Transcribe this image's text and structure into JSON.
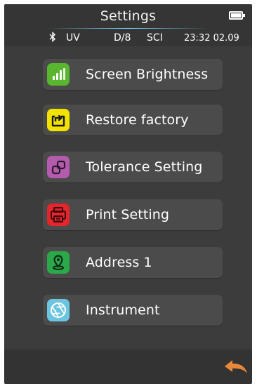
{
  "header": {
    "title": "Settings",
    "battery_icon": "battery-full-icon"
  },
  "status_bar": {
    "bluetooth_icon": "bluetooth-icon",
    "light_source": "UV",
    "geometry": "D/8",
    "specular": "SCI",
    "time": "23:32",
    "date": "02.09"
  },
  "menu": {
    "items": [
      {
        "label": "Screen Brightness",
        "icon": "brightness-bars-icon",
        "color": "#5ab52f"
      },
      {
        "label": "Restore factory",
        "icon": "restore-icon",
        "color": "#f2e200"
      },
      {
        "label": "Tolerance Setting",
        "icon": "tolerance-icon",
        "color": "#b45bad"
      },
      {
        "label": "Print Setting",
        "icon": "printer-icon",
        "color": "#e5242b"
      },
      {
        "label": "Address 1",
        "icon": "location-pin-icon",
        "color": "#2aa84a"
      },
      {
        "label": "Instrument",
        "icon": "aperture-icon",
        "color": "#6cc5e0"
      }
    ]
  },
  "footer": {
    "back_icon": "back-arrow-icon",
    "back_color": "#e8893a"
  }
}
